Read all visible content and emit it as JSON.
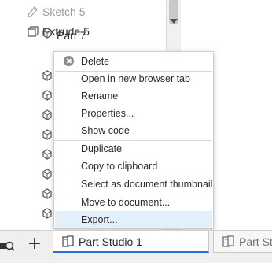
{
  "feature_tree": {
    "sketch_label": "Sketch 5",
    "extrude_label": "Extrude 5",
    "part_label": "Part 7"
  },
  "context_menu": {
    "items": [
      "Delete",
      "Open in new browser tab",
      "Rename",
      "Properties...",
      "Show code",
      "Duplicate",
      "Copy to clipboard",
      "Select as document thumbnail",
      "Move to document...",
      "Export..."
    ]
  },
  "tab_bar": {
    "add_label": "+",
    "active_tab_label": "Part Studio 1",
    "inactive_tab_label": "Part St"
  },
  "colors": {
    "active_tab_underline": "#2a6fd6",
    "menu_highlight": "#e3f0fa"
  }
}
